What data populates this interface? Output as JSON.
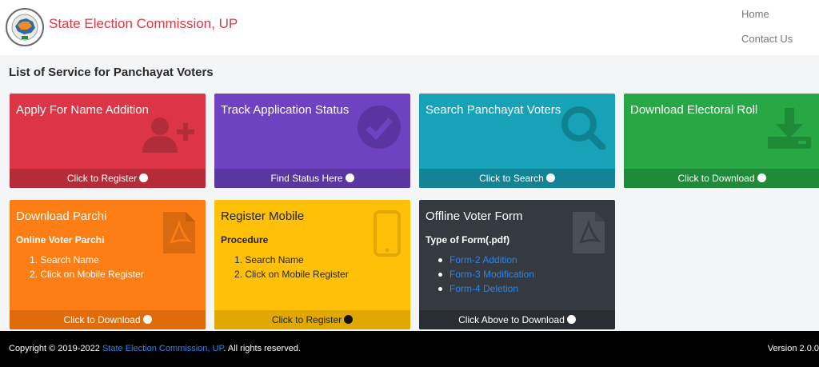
{
  "header": {
    "brand": "State Election Commission, UP",
    "nav": {
      "home": "Home",
      "contact": "Contact Us"
    }
  },
  "page_title": "List of Service for Panchayat Voters",
  "cards": {
    "add": {
      "title": "Apply For Name Addition",
      "footer": "Click to Register",
      "color": "#dc3545",
      "icon": "user-plus-icon"
    },
    "track": {
      "title": "Track Application Status",
      "footer": "Find Status Here",
      "color": "#6f42c1",
      "icon": "check-circle-icon"
    },
    "search": {
      "title": "Search Panchayat Voters",
      "footer": "Click to Search",
      "color": "#17a2b8",
      "icon": "search-icon"
    },
    "roll": {
      "title": "Download Electoral Roll",
      "footer": "Click to Download",
      "color": "#28a745",
      "icon": "download-icon"
    },
    "parchi": {
      "title": "Download Parchi",
      "subtitle": "Online Voter Parchi",
      "steps": [
        "1. Search Name",
        "2. Click on Mobile Register"
      ],
      "footer": "Click to Download",
      "color": "#fd7e14",
      "icon": "pdf-file-icon"
    },
    "mobile": {
      "title": "Register Mobile",
      "subtitle": "Procedure",
      "steps": [
        "1. Search Name",
        "2. Click on Mobile Register"
      ],
      "footer": "Click to Register",
      "color": "#ffc107",
      "icon": "mobile-phone-icon"
    },
    "offline": {
      "title": "Offline Voter Form",
      "subtitle": "Type of Form(.pdf)",
      "forms": [
        "Form-2 Addition",
        "Form-3 Modification",
        "Form-4 Deletion"
      ],
      "footer": "Click Above to Download",
      "color": "#343a40",
      "icon": "pdf-file-icon"
    }
  },
  "footer": {
    "copy_prefix": "Copyright © 2019-2022",
    "copy_link": "State Election Commission, UP",
    "copy_suffix": ". All rights reserved.",
    "version": "Version 2.0.0"
  }
}
